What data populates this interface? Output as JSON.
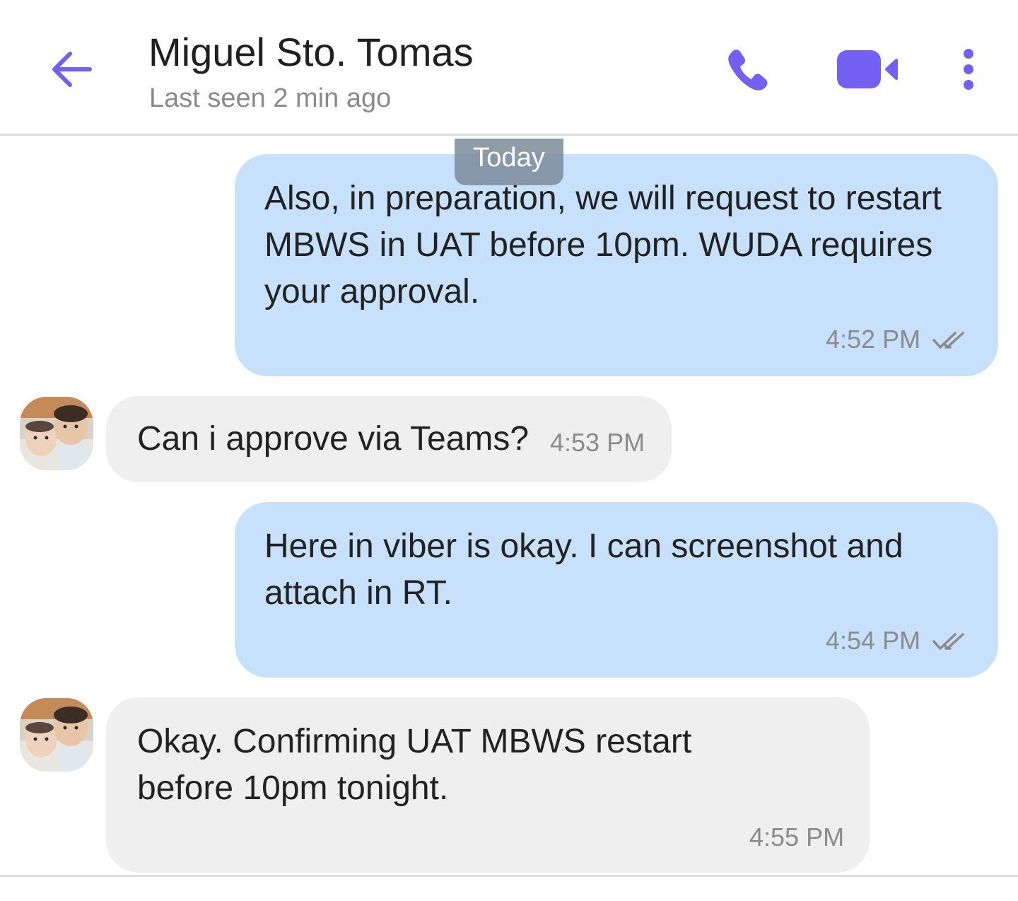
{
  "header": {
    "contact_name": "Miguel Sto. Tomas",
    "status": "Last seen 2 min ago",
    "icons": [
      "arrow-left-icon",
      "phone-icon",
      "video-camera-icon",
      "more-vertical-icon"
    ],
    "accent_color": "#7360f2"
  },
  "date_separator": "Today",
  "messages": [
    {
      "direction": "outgoing",
      "text": "Also, in preparation, we will request to restart MBWS in UAT before 10pm. WUDA requires your approval.",
      "time": "4:52 PM",
      "status": "read"
    },
    {
      "direction": "incoming",
      "text": "Can i approve via Teams?",
      "time": "4:53 PM"
    },
    {
      "direction": "outgoing",
      "text": "Here in viber is okay. I can screenshot and attach in RT.",
      "time": "4:54 PM",
      "status": "read"
    },
    {
      "direction": "incoming",
      "text": "Okay. Confirming UAT MBWS restart before 10pm tonight.",
      "time": "4:55 PM"
    }
  ],
  "colors": {
    "outgoing_bubble": "#c7e0fb",
    "incoming_bubble": "#efefef",
    "date_pill": "#7c8b99"
  }
}
